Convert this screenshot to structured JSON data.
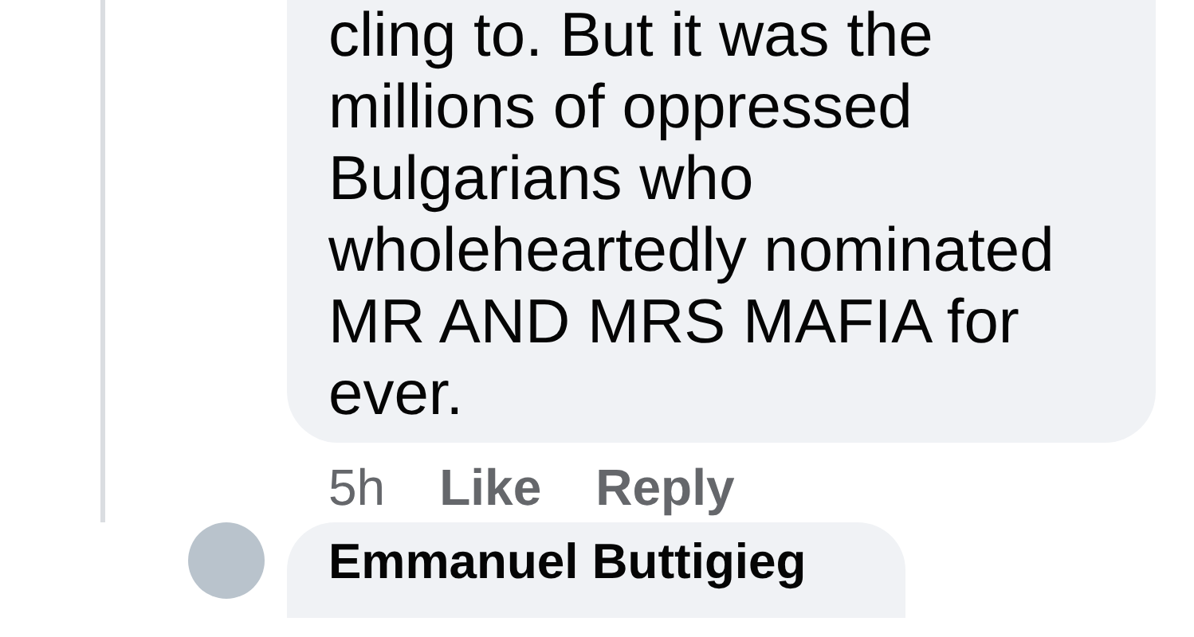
{
  "comment": {
    "text": "cling to. But it was the millions of oppressed Bulgarians who wholeheartedly nominated MR AND MRS MAFIA for ever.",
    "time": "5h",
    "actions": [
      {
        "label": "Like"
      },
      {
        "label": "Reply"
      }
    ]
  },
  "reply": {
    "author": "Emmanuel Buttigieg"
  }
}
